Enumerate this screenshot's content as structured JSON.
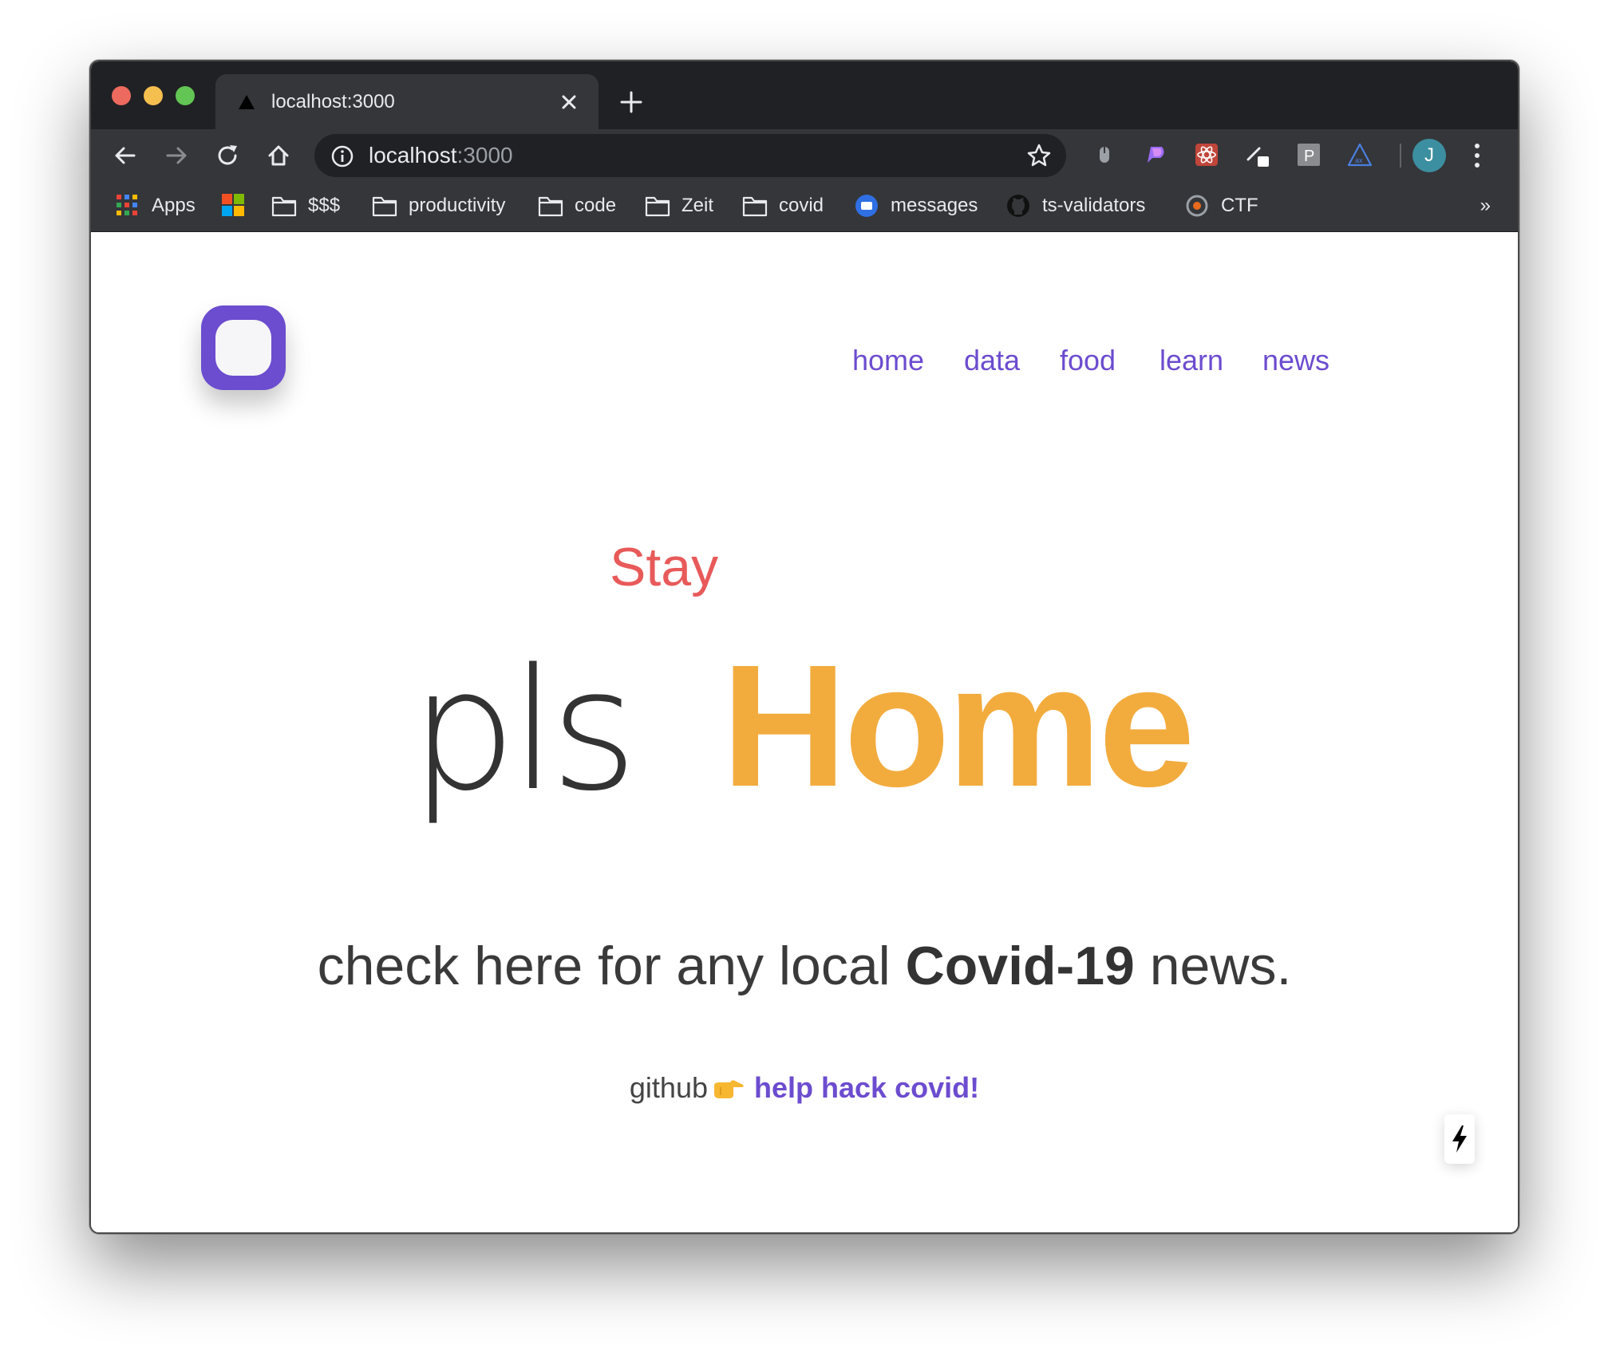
{
  "tab": {
    "title": "localhost:3000"
  },
  "omnibox": {
    "host": "localhost",
    "port": ":3000"
  },
  "profile": {
    "initial": "J"
  },
  "bookmarks": [
    {
      "label": "Apps",
      "icon": "apps-grid-icon"
    },
    {
      "label": "",
      "icon": "microsoft-logo-icon"
    },
    {
      "label": "$$$",
      "icon": "folder-icon"
    },
    {
      "label": "productivity",
      "icon": "folder-icon"
    },
    {
      "label": "code",
      "icon": "folder-icon"
    },
    {
      "label": "Zeit",
      "icon": "folder-icon"
    },
    {
      "label": "covid",
      "icon": "folder-icon"
    },
    {
      "label": "messages",
      "icon": "messages-icon"
    },
    {
      "label": "ts-validators",
      "icon": "github-icon"
    },
    {
      "label": "CTF",
      "icon": "ctf-icon"
    }
  ],
  "bookmarks_overflow": "»",
  "nav": {
    "home": "home",
    "data": "data",
    "food": "food",
    "learn": "learn",
    "news": "news"
  },
  "hero": {
    "stay": "Stay",
    "pls": "pls",
    "home": "Home"
  },
  "tagline": {
    "before": "check here for any local ",
    "bold": "Covid-19",
    "after": " news."
  },
  "github": {
    "prefix": "github",
    "link": "help hack covid!"
  },
  "colors": {
    "accent": "#6c4ccf",
    "stay": "#e85a5a",
    "home": "#f2ac3e",
    "chrome_dark": "#202124",
    "chrome_toolbar": "#35363a"
  }
}
